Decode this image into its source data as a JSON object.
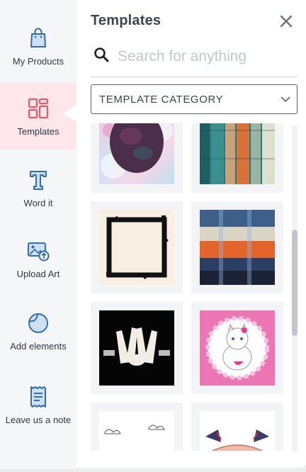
{
  "sidebar": {
    "items": [
      {
        "label": "My Products",
        "icon": "shopping-bag-icon"
      },
      {
        "label": "Templates",
        "icon": "templates-grid-icon"
      },
      {
        "label": "Word it",
        "icon": "text-t-icon"
      },
      {
        "label": "Upload Art",
        "icon": "upload-image-icon"
      },
      {
        "label": "Add elements",
        "icon": "shapes-icon"
      },
      {
        "label": "Leave us a note",
        "icon": "note-icon"
      }
    ],
    "active_index": 1
  },
  "panel": {
    "title": "Templates",
    "search": {
      "placeholder": "Search for anything",
      "value": ""
    },
    "category": {
      "label": "TEMPLATE CATEGORY"
    }
  },
  "templates": [
    {
      "name": "watercolor-clouds-dark-circle"
    },
    {
      "name": "wood-planks-teal-orange"
    },
    {
      "name": "black-grunge-frame"
    },
    {
      "name": "painted-grunge-stripes"
    },
    {
      "name": "crossed-hands-tattoo-black"
    },
    {
      "name": "white-kitten-pink-frame"
    },
    {
      "name": "rainbow-clouds"
    },
    {
      "name": "swallows-ribbon-banner"
    }
  ],
  "colors": {
    "accent": "#e85a6b",
    "icon_blue": "#3a74b8",
    "active_bg": "#fde7ea"
  }
}
